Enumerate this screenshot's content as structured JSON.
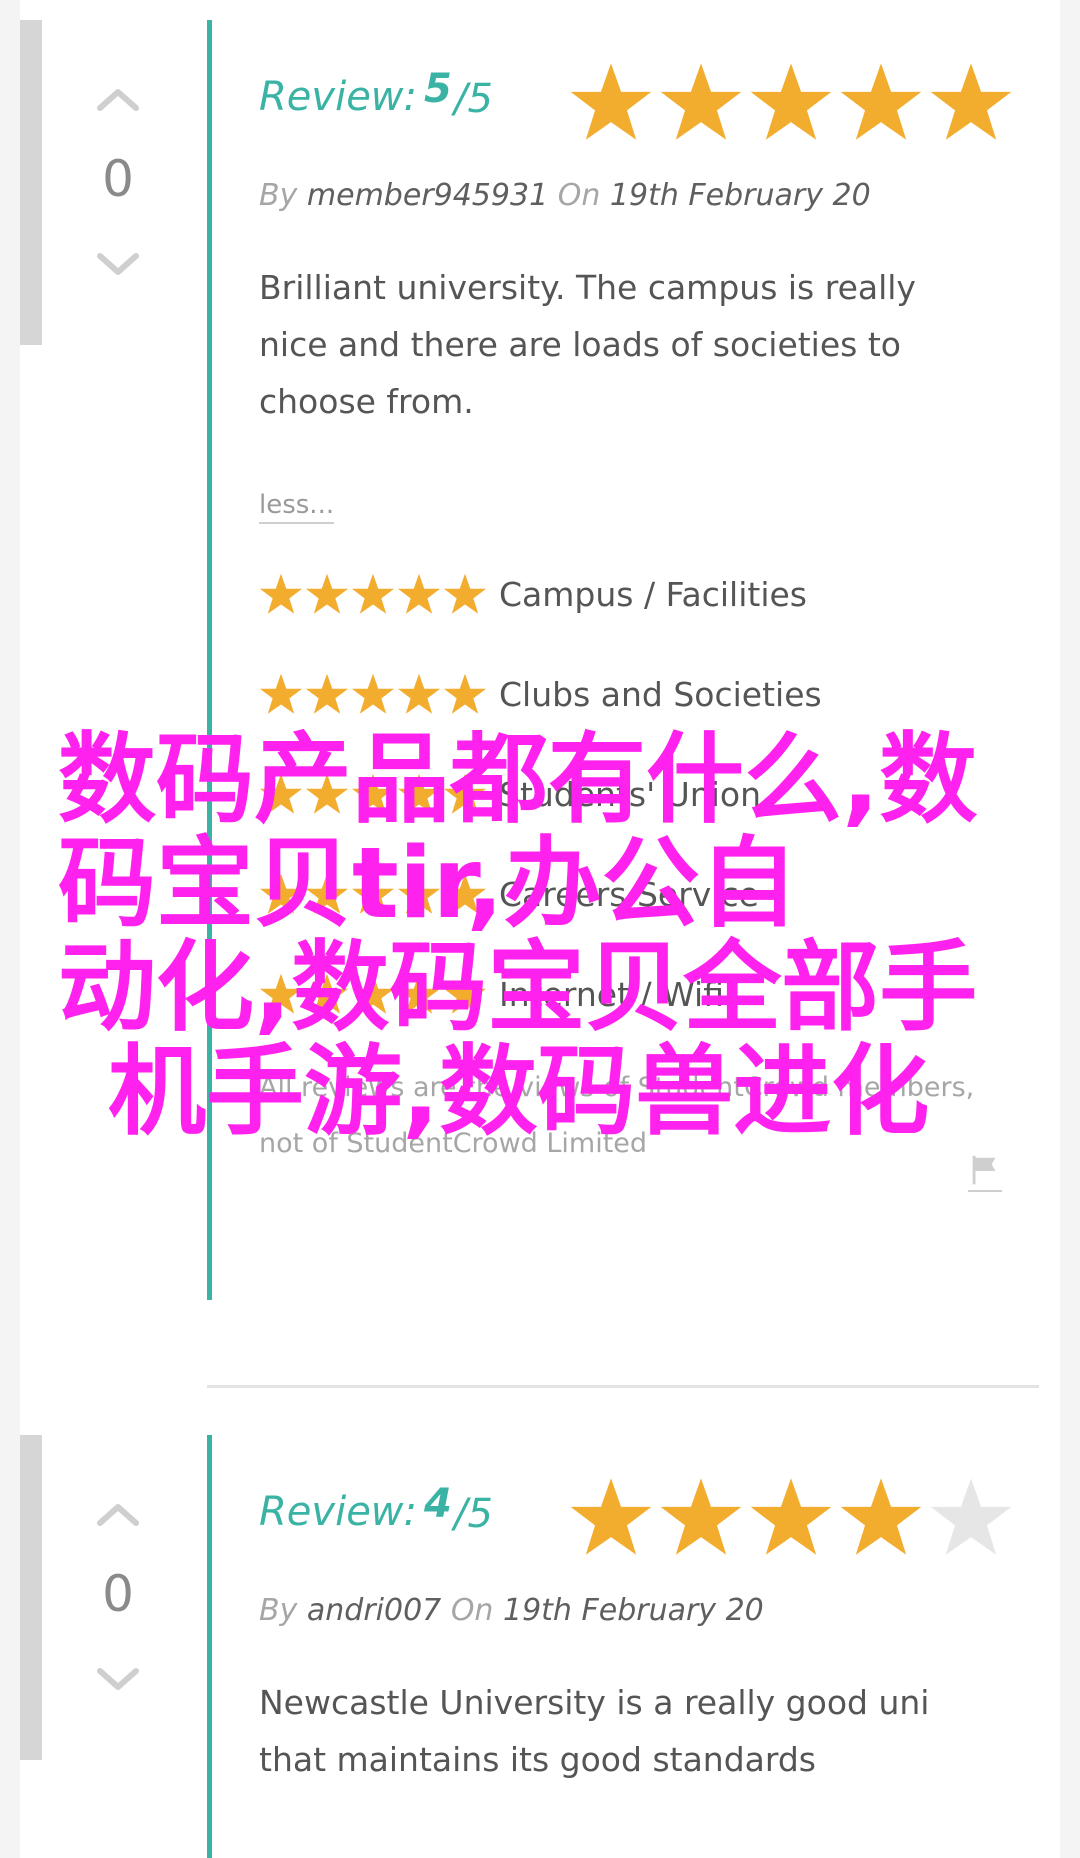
{
  "reviews": [
    {
      "votes": "0",
      "review_label": "Review:",
      "score": "5",
      "score_max": "/5",
      "rating": 5,
      "by_label": "By",
      "author": "member945931",
      "on_label": "On",
      "date": "19th February 20",
      "text": "Brilliant university. The campus is really nice and there are loads of societies to choose from.",
      "less_label": "less...",
      "categories": [
        {
          "label": "Campus / Facilities",
          "rating": 5
        },
        {
          "label": "Clubs and Societies",
          "rating": 5
        },
        {
          "label": "Students' Union",
          "rating": 5
        },
        {
          "label": "Careers Service",
          "rating": 5
        },
        {
          "label": "Internet / Wifi",
          "rating": 5
        }
      ],
      "disclaimer": "All reviews are the views of StudentCrowd members, not of StudentCrowd Limited"
    },
    {
      "votes": "0",
      "review_label": "Review:",
      "score": "4",
      "score_max": "/5",
      "rating": 4,
      "by_label": "By",
      "author": "andri007",
      "on_label": "On",
      "date": "19th February 20",
      "text": "Newcastle University is a really good uni that maintains its good standards"
    }
  ],
  "overlay": {
    "lines": [
      "数码产品都有什么,数",
      "码宝贝tir,办公自",
      "动化,数码宝贝全部手",
      "机手游,数码兽进化"
    ]
  },
  "colors": {
    "accent": "#3ab3a5",
    "star_filled": "#f2ac2e",
    "star_empty": "#e6e6e6",
    "overlay_text": "#ff22ee"
  },
  "icons": {
    "vote_up": "chevron-up-icon",
    "vote_down": "chevron-down-icon",
    "star": "star-icon",
    "flag": "flag-icon"
  }
}
